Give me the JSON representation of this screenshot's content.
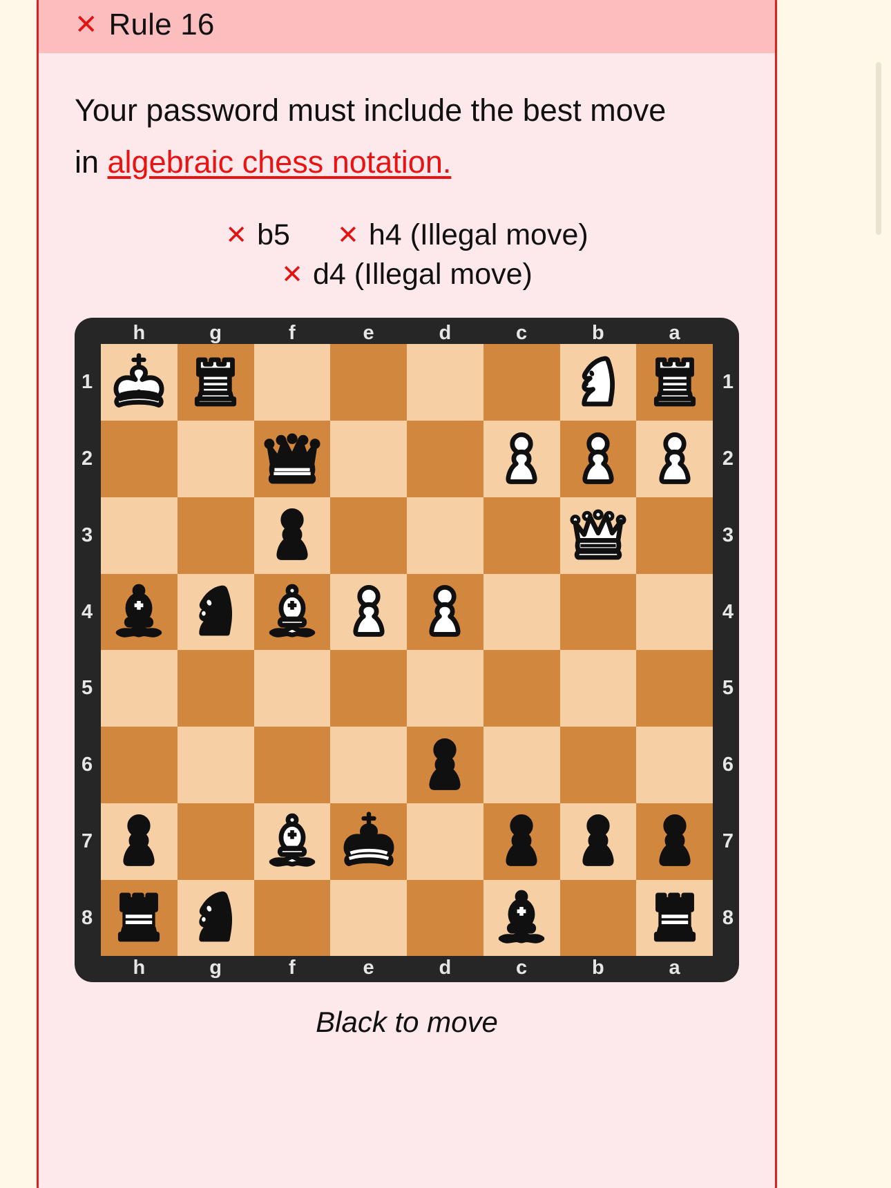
{
  "theme": {
    "page_bg": "#fdf8e8",
    "card_bg": "#fde9ec",
    "card_border": "#e02020",
    "header_bg": "#fbbdbd",
    "error_red": "#e11414",
    "link_red": "#e81313",
    "board_frame": "#262626",
    "square_light": "#f6cfa4",
    "square_dark": "#d2873f"
  },
  "rule": {
    "status_icon": "x-mark-icon",
    "title": "Rule 16",
    "text_before_link": "Your password must include the best move in ",
    "link_text": "algebraic chess notation.",
    "text_line1": "Your password must include the best move",
    "text_line2_prefix": "in ",
    "link": "algebraic chess notation."
  },
  "attempts": {
    "rows": [
      [
        {
          "icon": "x-mark-icon",
          "label": "b5"
        },
        {
          "icon": "x-mark-icon",
          "label": "h4 (Illegal move)"
        }
      ],
      [
        {
          "icon": "x-mark-icon",
          "label": "d4 (Illegal move)"
        }
      ]
    ]
  },
  "board": {
    "orientation": "black",
    "files": [
      "h",
      "g",
      "f",
      "e",
      "d",
      "c",
      "b",
      "a"
    ],
    "ranks": [
      "1",
      "2",
      "3",
      "4",
      "5",
      "6",
      "7",
      "8"
    ],
    "caption": "Black to move",
    "rows": [
      [
        "wK",
        "wR",
        "",
        "",
        "",
        "",
        "wN",
        "wR"
      ],
      [
        "",
        "",
        "bQ",
        "",
        "",
        "wP",
        "wP",
        "wP"
      ],
      [
        "",
        "",
        "bP",
        "",
        "",
        "",
        "wQ",
        ""
      ],
      [
        "bB",
        "bN",
        "wB",
        "wP",
        "wP",
        "",
        "",
        ""
      ],
      [
        "",
        "",
        "",
        "",
        "",
        "",
        "",
        ""
      ],
      [
        "",
        "",
        "",
        "",
        "bP",
        "",
        "",
        ""
      ],
      [
        "bP",
        "",
        "wB",
        "bK",
        "",
        "bP",
        "bP",
        "bP"
      ],
      [
        "bR",
        "bN",
        "",
        "",
        "",
        "bB",
        "",
        "bR"
      ]
    ],
    "piece_names": {
      "wK": "white-king",
      "wQ": "white-queen",
      "wR": "white-rook",
      "wB": "white-bishop",
      "wN": "white-knight",
      "wP": "white-pawn",
      "bK": "black-king",
      "bQ": "black-queen",
      "bR": "black-rook",
      "bB": "black-bishop",
      "bN": "black-knight",
      "bP": "black-pawn"
    },
    "piece_glyphs": {
      "wK": "♔",
      "wQ": "♕",
      "wR": "♖",
      "wB": "♗",
      "wN": "♘",
      "wP": "♙",
      "bK": "♚",
      "bQ": "♛",
      "bR": "♜",
      "bB": "♝",
      "bN": "♞",
      "bP": "♟"
    }
  },
  "scrollbar": {
    "name": "vertical-scrollbar"
  }
}
